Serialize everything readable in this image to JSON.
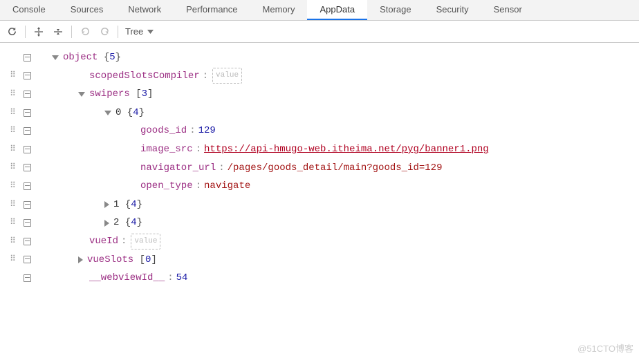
{
  "tabs": {
    "items": [
      "Console",
      "Sources",
      "Network",
      "Performance",
      "Memory",
      "AppData",
      "Storage",
      "Security",
      "Sensor"
    ],
    "activeIndex": 5
  },
  "toolbar": {
    "viewMode": "Tree"
  },
  "tree": {
    "root": {
      "key": "object",
      "count": "5"
    },
    "scopedSlotsCompiler": {
      "key": "scopedSlotsCompiler",
      "placeholder": "value"
    },
    "swipers": {
      "key": "swipers",
      "count": "3"
    },
    "item0": {
      "idx": "0",
      "count": "4"
    },
    "goods_id": {
      "key": "goods_id",
      "val": "129"
    },
    "image_src": {
      "key": "image_src",
      "val": "https://api-hmugo-web.itheima.net/pyg/banner1.png"
    },
    "navigator_url": {
      "key": "navigator_url",
      "val": "/pages/goods_detail/main?goods_id=129"
    },
    "open_type": {
      "key": "open_type",
      "val": "navigate"
    },
    "item1": {
      "idx": "1",
      "count": "4"
    },
    "item2": {
      "idx": "2",
      "count": "4"
    },
    "vueId": {
      "key": "vueId",
      "placeholder": "value"
    },
    "vueSlots": {
      "key": "vueSlots",
      "count": "0"
    },
    "webviewId": {
      "key": "__webviewId__",
      "val": "54"
    }
  },
  "watermark": "@51CTO博客"
}
